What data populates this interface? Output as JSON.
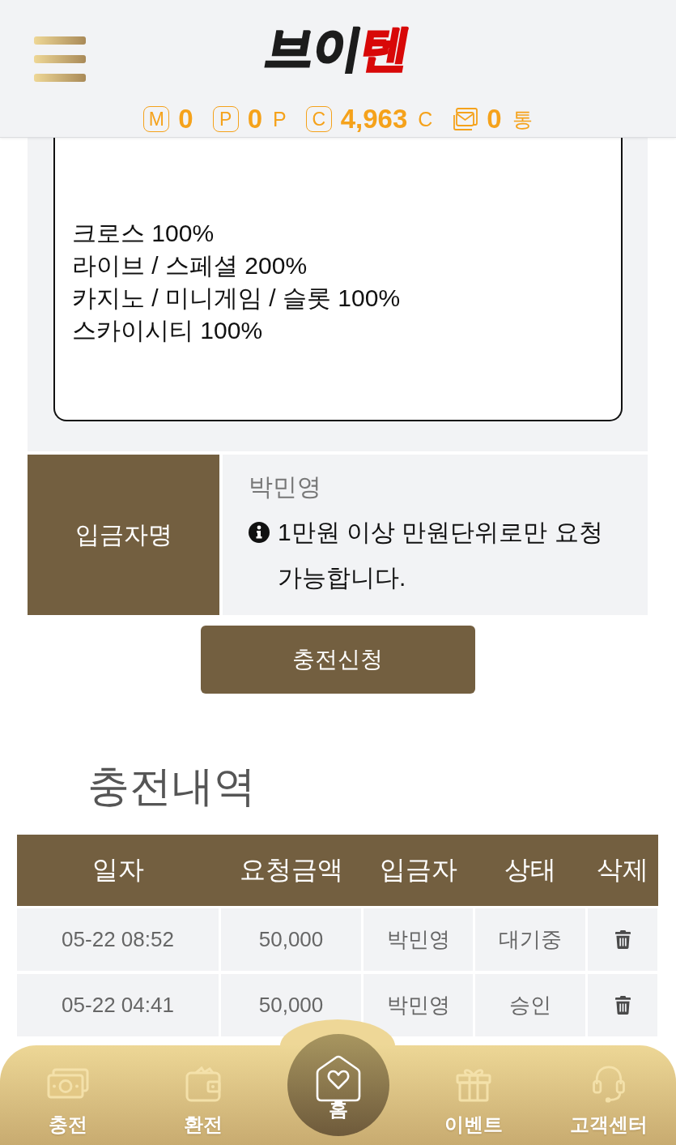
{
  "header": {
    "logo": {
      "text": "브이",
      "accent": "텐"
    },
    "stats": [
      {
        "kind": "letter",
        "badge": "M",
        "value": "0"
      },
      {
        "kind": "letter",
        "badge": "P",
        "value": "0",
        "unit": "P"
      },
      {
        "kind": "letter",
        "badge": "C",
        "value": "4,963",
        "unit": "C"
      },
      {
        "kind": "mail",
        "value": "0",
        "unit": "통"
      }
    ]
  },
  "notice": {
    "lines": [
      "크로스 100%",
      "라이브 / 스페셜 200%",
      "카지노 / 미니게임 / 슬롯 100%",
      "스카이시티 100%"
    ]
  },
  "depositor": {
    "label": "입금자명",
    "value": "박민영",
    "hint": "1만원 이상 만원단위로만 요청 가능합니다."
  },
  "submit_button": "충전신청",
  "history": {
    "title": "충전내역",
    "columns": [
      "일자",
      "요청금액",
      "입금자",
      "상태",
      "삭제"
    ],
    "rows": [
      {
        "date": "05-22 08:52",
        "amount": "50,000",
        "depositor": "박민영",
        "status": "대기중"
      },
      {
        "date": "05-22 04:41",
        "amount": "50,000",
        "depositor": "박민영",
        "status": "승인"
      }
    ]
  },
  "bottom_nav": [
    {
      "kind": "tab",
      "label": "충전"
    },
    {
      "kind": "tab",
      "label": "환전"
    },
    {
      "kind": "center",
      "label": "홈"
    },
    {
      "kind": "tab",
      "label": "이벤트"
    },
    {
      "kind": "tab",
      "label": "고객센터"
    }
  ]
}
